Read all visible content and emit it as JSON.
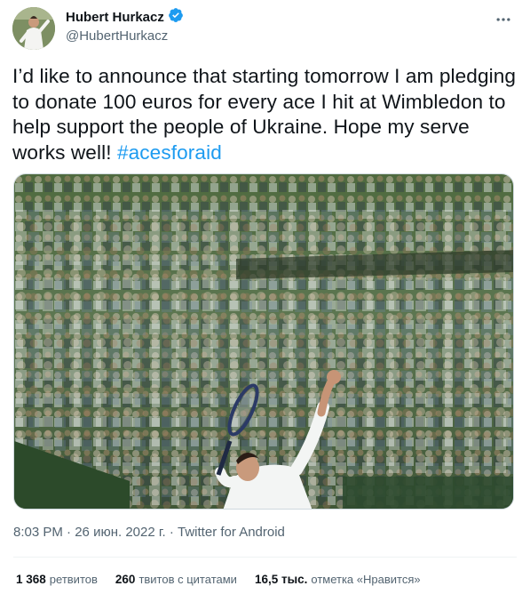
{
  "author": {
    "display_name": "Hubert Hurkacz",
    "handle": "@HubertHurkacz",
    "verified_icon": "verified-badge-icon",
    "avatar_icon": "avatar"
  },
  "tweet": {
    "text_main": "I’d like to announce that starting tomorrow I am pledging to donate 100 euros for every ace I hit at Wimbledon to help support the people of Ukraine. Hope my serve works well! ",
    "hashtag": "#acesforaid",
    "media_icon": "tennis-serve-photo"
  },
  "meta": {
    "time": "8:03 PM",
    "separator1": " · ",
    "date": "26 июн. 2022 г.",
    "separator2": " · ",
    "source": "Twitter for Android"
  },
  "stats": {
    "retweets_count": "1 368",
    "retweets_label": "ретвитов",
    "quotes_count": "260",
    "quotes_label": "твитов с цитатами",
    "likes_count": "16,5 тыс.",
    "likes_label": "отметка «Нравится»"
  },
  "colors": {
    "accent": "#1d9bf0",
    "text": "#0f1419",
    "secondary": "#536471",
    "divider": "#eff3f4"
  }
}
